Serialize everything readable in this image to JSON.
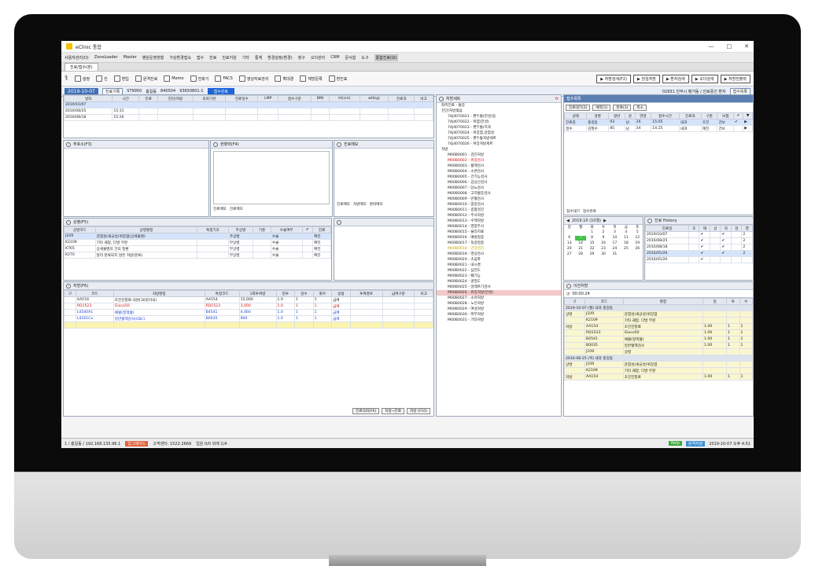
{
  "window": {
    "title": "eClinic 통합",
    "controls": [
      "—",
      "□",
      "✕"
    ]
  },
  "menubar": [
    "사용자관리(D)",
    "ZoneLoader",
    "Master",
    "병원운영현황",
    "가상환경접속",
    "접수",
    "진료",
    "진료지원",
    "기타",
    "통계",
    "환경설정(환경)",
    "청구",
    "오더관리",
    "CRM",
    "문서함",
    "도구",
    "통합진료(보)"
  ],
  "doc_tab": "진료/접수(본)",
  "toolbar": {
    "left": [
      "설정",
      "진",
      "환입",
      "원격진료",
      "Memo",
      "전화기",
      "FACS",
      "영상자료관리",
      "확대경",
      "재방문록",
      "환진표"
    ],
    "right": [
      "▶ 처방검색(F2)",
      "▶ 당일처방",
      "▶ 환자검색",
      "▶ 오더검색",
      "▶ 처방전출력"
    ]
  },
  "patient_bar": {
    "date": "2019-10-07",
    "btn1": "진료기록",
    "code": "ST9950",
    "name": "홍길동",
    "id": "840504",
    "age": "93650801-1",
    "status": "접수완료",
    "info": "02931 진주시 평거동 / 진료중인 환자",
    "recall": "접수목록"
  },
  "top_grid": {
    "headers": [
      "일자",
      "시간",
      "진료",
      "진단/처방",
      "의뢰기관",
      "진료일수",
      "LMP",
      "접수구분",
      "BMI",
      "ht(cm)",
      "wt(kg)",
      "진료과",
      "비고"
    ],
    "rows": [
      [
        "2019/10/07",
        "",
        "",
        "",
        "",
        "",
        "",
        "",
        "",
        "",
        "",
        "",
        ""
      ],
      [
        "2016/08/25",
        "15:31",
        "",
        "",
        "",
        "",
        "",
        "",
        "",
        "",
        "",
        "",
        ""
      ],
      [
        "2016/08/18",
        "15:26",
        "",
        "",
        "",
        "",
        "",
        "",
        "",
        "",
        "",
        "",
        ""
      ]
    ]
  },
  "panels": {
    "chief": "주호소(F3)",
    "history": "현병력(F4)",
    "note": "진료메모",
    "note_tabs": [
      "진료메모",
      "처방메모",
      "환자메모"
    ],
    "hist_tabs": [
      "진료메모",
      "진료메모"
    ]
  },
  "diagnosis": {
    "title": "상병(F5)",
    "headers": [
      "상병코드",
      "상병명칭",
      "특정기호",
      "주상병",
      "기준",
      "수술여부",
      "✔",
      "진료"
    ],
    "rows": [
      [
        "J109",
        "감염성(세균성)위장염(상세불명)",
        "",
        "주상병",
        "",
        "수술",
        "",
        "확진"
      ],
      [
        "K2109",
        "기타 궤양, 다발 부분",
        "",
        "부상병",
        "",
        "수술",
        "",
        "확진"
      ],
      [
        "K765",
        "상세불명의 간의 질환",
        "",
        "부상병",
        "",
        "수술",
        "",
        "확진"
      ],
      [
        "K270",
        "달리 분류되지 않은 처방(분류)",
        "",
        "부상병",
        "",
        "수술",
        "",
        "확진"
      ]
    ]
  },
  "order": {
    "title": "처방(F6)",
    "headers": [
      "구",
      "코드",
      "처방명칭",
      "특정코드",
      "1회투여량",
      "일투",
      "일수",
      "횟수",
      "용법",
      "투여경로",
      "급여구분",
      "비고"
    ],
    "rows": [
      [
        "",
        "AA154",
        "초진진찰료-의원(30일이내)",
        "AA154",
        "15,000",
        "1.0",
        "1",
        "1",
        "급여",
        "",
        "",
        ""
      ],
      [
        "",
        "RD1523",
        "Gluco50",
        "RD1523",
        "3,000",
        "1.0",
        "1",
        "1",
        "급여",
        "",
        "",
        ""
      ],
      [
        "",
        "L4540A1",
        "채혈(정맥혈)",
        "B4541",
        "4,460",
        "1.0",
        "1",
        "1",
        "급여",
        "",
        "",
        ""
      ],
      [
        "",
        "L4161Ca",
        "일반혈액검사(CBC)",
        "B0035",
        "900",
        "1.0",
        "1",
        "1",
        "급여",
        "",
        "",
        ""
      ]
    ],
    "footer_buttons": [
      "진료의뢰(F6)",
      "처방→진료",
      "처방 (F10)"
    ]
  },
  "tree": {
    "title": "처방세트",
    "items": [
      {
        "t": "좌측진료 - 통증",
        "c": ""
      },
      {
        "t": "진단/처방묶음",
        "c": ""
      },
      {
        "t": "74J4070021 - 편두통(만성)등",
        "c": "l2"
      },
      {
        "t": "74J4070022 - 위염(만성)",
        "c": "l2"
      },
      {
        "t": "74J4070023 - 편두통/치과",
        "c": "l2"
      },
      {
        "t": "74J4070024 - 위장염,감염성",
        "c": "l2"
      },
      {
        "t": "74J4070025 - 편두통처방세트",
        "c": "l2"
      },
      {
        "t": "74J4070026 - 위장처방세트",
        "c": "l2"
      },
      {
        "t": "처방",
        "c": ""
      },
      {
        "t": "M00B0001 - 검진처방",
        "c": "l2"
      },
      {
        "t": "M00B0002 - 위장검사",
        "c": "l2 red"
      },
      {
        "t": "M00B0003 - 혈액검사",
        "c": "l2"
      },
      {
        "t": "M00B0004 - 소변검사",
        "c": "l2"
      },
      {
        "t": "M00B0005 - 간기능검사",
        "c": "l2"
      },
      {
        "t": "M00B0006 - 갑상선검사",
        "c": "l2"
      },
      {
        "t": "M00B0007 - 당뇨검사",
        "c": "l2"
      },
      {
        "t": "M00B0008 - 고지혈증검사",
        "c": "l2"
      },
      {
        "t": "M00B0009 - 빈혈검사",
        "c": "l2"
      },
      {
        "t": "M00B0010 - 염증검사",
        "c": "l2"
      },
      {
        "t": "M00B0011 - 종합검진",
        "c": "l2"
      },
      {
        "t": "M00B0012 - 주사처방",
        "c": "l2"
      },
      {
        "t": "M00B0013 - 수액처방",
        "c": "l2"
      },
      {
        "t": "M00B0014 - 영양주사",
        "c": "l2"
      },
      {
        "t": "M00B0015 - 물리치료",
        "c": "l2"
      },
      {
        "t": "M00B0016 - 예방접종",
        "c": "l2"
      },
      {
        "t": "M00B0017 - 독감접종",
        "c": "l2"
      },
      {
        "t": "M00B0018 - 건강검진",
        "c": "l2 yellow"
      },
      {
        "t": "M00B0019 - 영상검사",
        "c": "l2"
      },
      {
        "t": "M00B0020 - 초음파",
        "c": "l2"
      },
      {
        "t": "M00B0021 - 내시경",
        "c": "l2"
      },
      {
        "t": "M00B0022 - 심전도",
        "c": "l2"
      },
      {
        "t": "M00B0023 - 폐기능",
        "c": "l2"
      },
      {
        "t": "M00B0024 - 골밀도",
        "c": "l2"
      },
      {
        "t": "M00B0025 - 알레르기검사",
        "c": "l2"
      },
      {
        "t": "M00B0026 - 위장처방(만성)",
        "c": "l2 sel"
      },
      {
        "t": "M00B0027 - 소아처방",
        "c": "l2"
      },
      {
        "t": "M00B0028 - 노인처방",
        "c": "l2"
      },
      {
        "t": "M00B0029 - 여성처방",
        "c": "l2"
      },
      {
        "t": "M00B0030 - 피부처방",
        "c": "l2"
      },
      {
        "t": "M00B0031 - 기타처방",
        "c": "l2"
      }
    ]
  },
  "reception": {
    "title": "접수목록",
    "tabs": [
      "진료대기(2)",
      "예약(1)",
      "완료(3)",
      "취소"
    ],
    "headers": [
      "상태",
      "성명",
      "생년",
      "성",
      "연령",
      "접수시간",
      "진료과",
      "구분",
      "보험",
      "✔",
      "▼"
    ],
    "rows": [
      [
        "진료중",
        "홍길동",
        "93",
        "남",
        "26",
        "15:05",
        "내과",
        "초진",
        "건보",
        "✔",
        "▶"
      ],
      [
        "접수",
        "김철수",
        "85",
        "남",
        "34",
        "14:25",
        "내과",
        "재진",
        "건보",
        "",
        "▶"
      ]
    ],
    "bottom_tabs": [
      "접수대기",
      "접수완료"
    ]
  },
  "calendar": {
    "month": "2019.10 (10월)",
    "days": [
      "일",
      "월",
      "화",
      "수",
      "목",
      "금",
      "토"
    ],
    "weeks": [
      [
        "",
        "",
        "1",
        "2",
        "3",
        "4",
        "5"
      ],
      [
        "6",
        "7",
        "8",
        "9",
        "10",
        "11",
        "12"
      ],
      [
        "13",
        "14",
        "15",
        "16",
        "17",
        "18",
        "19"
      ],
      [
        "20",
        "21",
        "22",
        "23",
        "24",
        "25",
        "26"
      ],
      [
        "27",
        "28",
        "29",
        "30",
        "31",
        "",
        ""
      ]
    ],
    "today": "7"
  },
  "visit_history": {
    "title": "진료 History",
    "headers": [
      "진료일",
      "초",
      "재",
      "상",
      "처",
      "검",
      "영"
    ],
    "rows": [
      [
        "2019/10/07",
        "",
        "✔",
        "",
        "✔",
        "",
        "2"
      ],
      [
        "2016/08/25",
        "",
        "✔",
        "",
        "✔",
        "",
        "2"
      ],
      [
        "2016/08/18",
        "",
        "✔",
        "",
        "✔",
        "",
        "2"
      ],
      [
        "2016/05/26",
        "",
        "✔",
        "",
        "✔",
        "",
        "2"
      ],
      [
        "2016/05/20",
        "",
        "✔",
        "",
        "",
        "",
        ""
      ]
    ]
  },
  "past_orders": {
    "title": "이전처방",
    "time": "00:00:24",
    "headers": [
      "구",
      "코드",
      "명칭",
      "일",
      "투",
      "수"
    ],
    "block1_hdr": "2019-10-07 (월) 내과 홍길동",
    "block1": [
      [
        "상병",
        "J109",
        "감염성(세균성)위장염"
      ],
      [
        "",
        "K2109",
        "기타 궤양, 다발 부분"
      ],
      [
        "처방",
        "AA154",
        "초진진찰료",
        "1.00",
        "1",
        "1"
      ],
      [
        "",
        "RD1523",
        "Gluco50",
        "1.00",
        "1",
        "1"
      ],
      [
        "",
        "B4541",
        "채혈(정맥혈)",
        "1.00",
        "1",
        "1"
      ],
      [
        "",
        "B0035",
        "일반혈액검사",
        "1.00",
        "1",
        "1"
      ],
      [
        "",
        "J109",
        "상병"
      ]
    ],
    "block2_hdr": "2016-08-25 (목) 내과 홍길동",
    "block2": [
      [
        "상병",
        "J109",
        "감염성(세균성)위장염"
      ],
      [
        "",
        "K2109",
        "기타 궤양, 다발 부분"
      ],
      [
        "처방",
        "AA154",
        "초진진찰료",
        "1.00",
        "1",
        "1"
      ]
    ]
  },
  "statusbar": {
    "left": "1 / 홍길동 / 192.168.135.96.1",
    "badge": "업그레이드",
    "server": "고객센터: 1522-2669",
    "info": "입원 0/0 외래 1/4",
    "right_badge1": "Help",
    "right_badge2": "원격지원",
    "datetime": "2019-10-07 오후 4:51"
  }
}
